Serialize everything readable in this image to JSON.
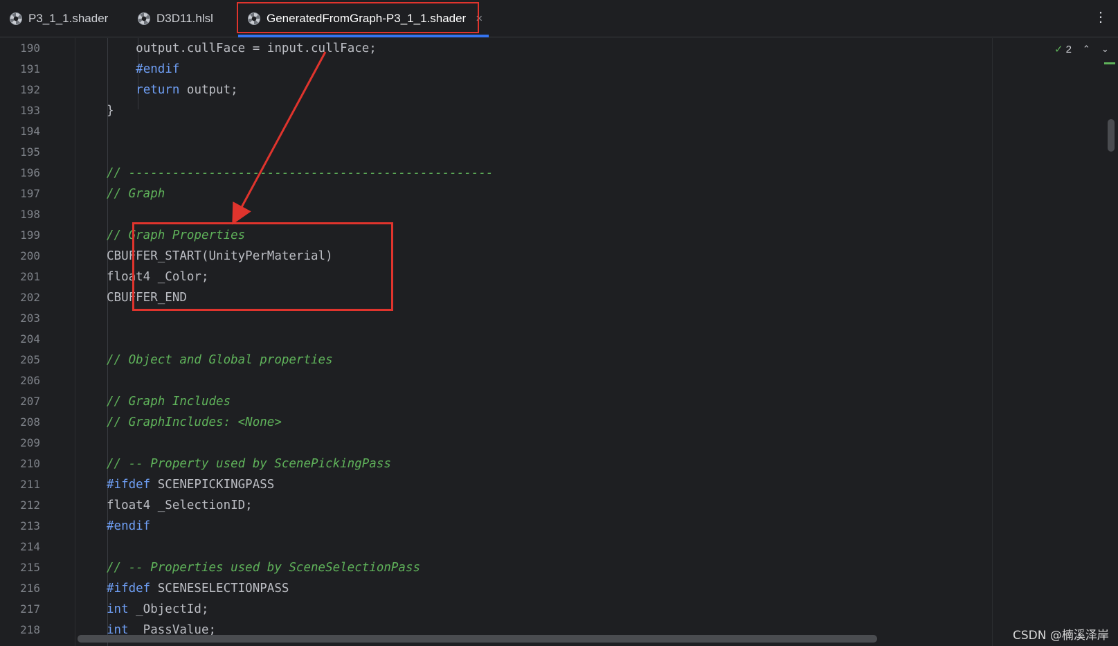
{
  "tabs": [
    {
      "label": "P3_1_1.shader",
      "active": false
    },
    {
      "label": "D3D11.hlsl",
      "active": false
    },
    {
      "label": "GeneratedFromGraph-P3_1_1.shader",
      "active": true
    }
  ],
  "tab_close_glyph": "×",
  "more_glyph": "⋮",
  "inspection": {
    "count": "2",
    "icon": "check-icon",
    "up": "^",
    "down": "v"
  },
  "code_lines": [
    {
      "num": "190",
      "indent": "    ",
      "tokens": [
        {
          "t": "output.cullFace = input.cullFace;",
          "c": ""
        }
      ]
    },
    {
      "num": "191",
      "indent": "    ",
      "tokens": [
        {
          "t": "#endif",
          "c": "kw"
        }
      ]
    },
    {
      "num": "192",
      "indent": "    ",
      "tokens": [
        {
          "t": "return",
          "c": "kw"
        },
        {
          "t": " output;",
          "c": ""
        }
      ]
    },
    {
      "num": "193",
      "indent": "",
      "tokens": [
        {
          "t": "}",
          "c": ""
        }
      ]
    },
    {
      "num": "194",
      "indent": "",
      "tokens": []
    },
    {
      "num": "195",
      "indent": "",
      "tokens": []
    },
    {
      "num": "196",
      "indent": "",
      "tokens": [
        {
          "t": "// --------------------------------------------------",
          "c": "cm"
        }
      ]
    },
    {
      "num": "197",
      "indent": "",
      "tokens": [
        {
          "t": "// Graph",
          "c": "cm"
        }
      ]
    },
    {
      "num": "198",
      "indent": "",
      "tokens": []
    },
    {
      "num": "199",
      "indent": "",
      "tokens": [
        {
          "t": "// Graph Properties",
          "c": "cm"
        }
      ]
    },
    {
      "num": "200",
      "indent": "",
      "tokens": [
        {
          "t": "CBUFFER_START(UnityPerMaterial)",
          "c": ""
        }
      ]
    },
    {
      "num": "201",
      "indent": "",
      "tokens": [
        {
          "t": "float4 _Color;",
          "c": ""
        }
      ]
    },
    {
      "num": "202",
      "indent": "",
      "tokens": [
        {
          "t": "CBUFFER_END",
          "c": ""
        }
      ]
    },
    {
      "num": "203",
      "indent": "",
      "tokens": []
    },
    {
      "num": "204",
      "indent": "",
      "tokens": []
    },
    {
      "num": "205",
      "indent": "",
      "tokens": [
        {
          "t": "// Object and Global properties",
          "c": "cm"
        }
      ]
    },
    {
      "num": "206",
      "indent": "",
      "tokens": []
    },
    {
      "num": "207",
      "indent": "",
      "tokens": [
        {
          "t": "// Graph Includes",
          "c": "cm"
        }
      ]
    },
    {
      "num": "208",
      "indent": "",
      "tokens": [
        {
          "t": "// GraphIncludes: <None>",
          "c": "cm"
        }
      ]
    },
    {
      "num": "209",
      "indent": "",
      "tokens": []
    },
    {
      "num": "210",
      "indent": "",
      "tokens": [
        {
          "t": "// -- Property used by ScenePickingPass",
          "c": "cm"
        }
      ]
    },
    {
      "num": "211",
      "indent": "",
      "tokens": [
        {
          "t": "#ifdef",
          "c": "kw"
        },
        {
          "t": " SCENEPICKINGPASS",
          "c": ""
        }
      ]
    },
    {
      "num": "212",
      "indent": "",
      "tokens": [
        {
          "t": "float4 _SelectionID;",
          "c": ""
        }
      ]
    },
    {
      "num": "213",
      "indent": "",
      "tokens": [
        {
          "t": "#endif",
          "c": "kw"
        }
      ]
    },
    {
      "num": "214",
      "indent": "",
      "tokens": []
    },
    {
      "num": "215",
      "indent": "",
      "tokens": [
        {
          "t": "// -- Properties used by SceneSelectionPass",
          "c": "cm"
        }
      ]
    },
    {
      "num": "216",
      "indent": "",
      "tokens": [
        {
          "t": "#ifdef",
          "c": "kw"
        },
        {
          "t": " SCENESELECTIONPASS",
          "c": ""
        }
      ]
    },
    {
      "num": "217",
      "indent": "",
      "tokens": [
        {
          "t": "int",
          "c": "kw"
        },
        {
          "t": " _ObjectId;",
          "c": ""
        }
      ]
    },
    {
      "num": "218",
      "indent": "",
      "tokens": [
        {
          "t": "int",
          "c": "kw"
        },
        {
          "t": " _PassValue;",
          "c": ""
        }
      ]
    }
  ],
  "watermark": "CSDN @楠溪泽岸",
  "colors": {
    "background": "#1e1f22",
    "keyword": "#6f9ff5",
    "comment": "#5fb25a",
    "annotation": "#e0342d",
    "active_tab_underline": "#3574f0"
  }
}
